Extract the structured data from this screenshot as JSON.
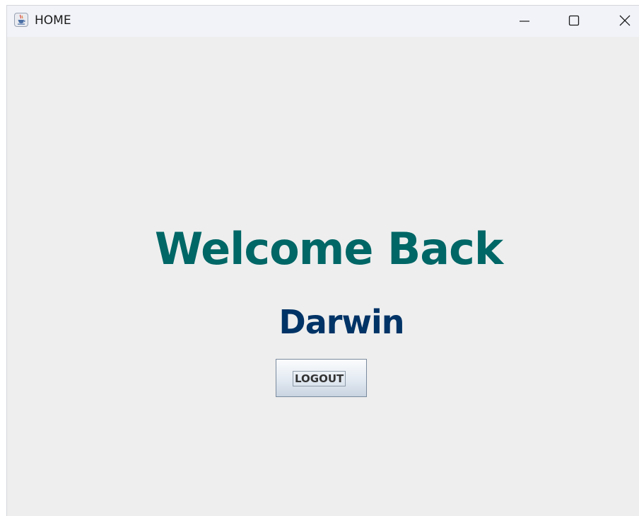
{
  "window": {
    "title": "HOME",
    "icon": "java-cup-icon",
    "controls": [
      "minimize-icon",
      "maximize-icon",
      "close-icon"
    ]
  },
  "main": {
    "welcome_text": "Welcome Back",
    "username": "Darwin",
    "logout_label": "LOGOUT"
  },
  "colors": {
    "welcome": "#006666",
    "username": "#003366",
    "background": "#eeeeee",
    "titlebar": "#f1f3f9"
  }
}
